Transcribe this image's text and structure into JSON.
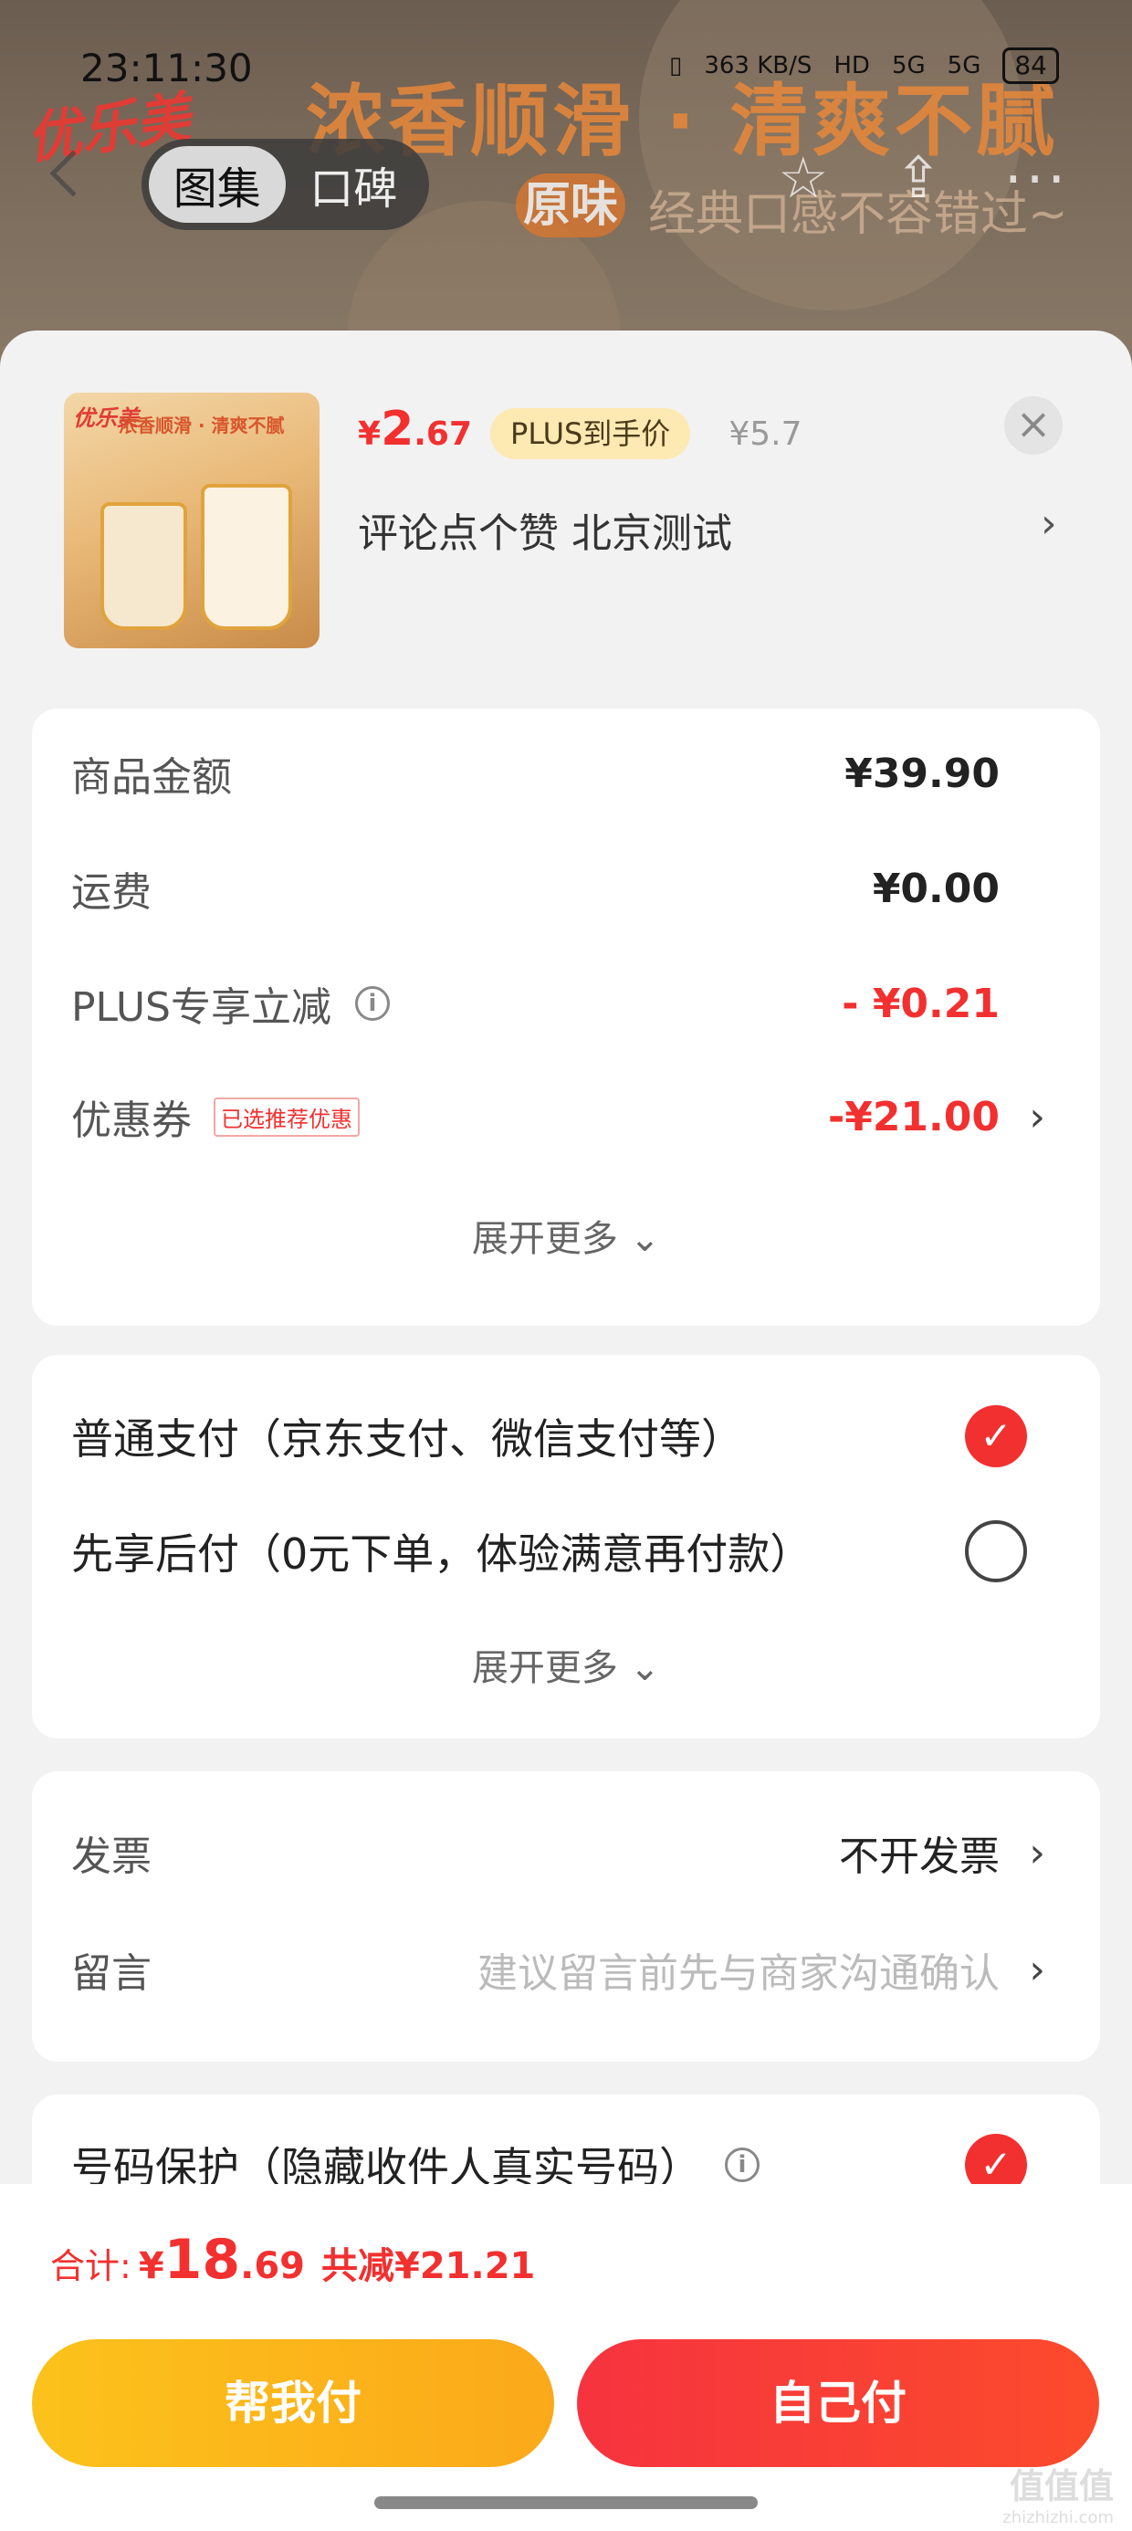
{
  "status_bar": {
    "time": "23:11:30",
    "net_speed": "363 KB/S",
    "hd": "HD",
    "sig1": "5G",
    "sig2": "5G",
    "battery": "84"
  },
  "banner": {
    "title": "浓香顺滑 · 清爽不腻",
    "badge": "原味",
    "subtitle": "经典口感不容错过~",
    "logo": "优乐美"
  },
  "nav": {
    "tab_gallery": "图集",
    "tab_reviews": "口碑",
    "star_icon": "☆",
    "share_icon": "⇪",
    "more_icon": "···"
  },
  "product": {
    "image_text": "浓香顺滑 · 清爽不腻",
    "image_logo": "优乐美",
    "price_symbol": "¥",
    "price_int": "2",
    "price_dec": ".67",
    "plus_tag": "PLUS到手价",
    "original_price": "¥5.7",
    "spec": "评论点个赞  北京测试",
    "close": "×"
  },
  "amounts": {
    "goods_label": "商品金额",
    "goods_value": "¥39.90",
    "shipping_label": "运费",
    "shipping_value": "¥0.00",
    "plus_label": "PLUS专享立减",
    "plus_value": "- ¥0.21",
    "coupon_label": "优惠券",
    "coupon_tag": "已选推荐优惠",
    "coupon_value": "-¥21.00",
    "expand": "展开更多 ⌄"
  },
  "payment": {
    "normal": "普通支付（京东支付、微信支付等）",
    "later": "先享后付（0元下单，体验满意再付款）",
    "expand": "展开更多 ⌄",
    "normal_selected": true
  },
  "extra": {
    "invoice_label": "发票",
    "invoice_value": "不开发票",
    "note_label": "留言",
    "note_placeholder": "建议留言前先与商家沟通确认"
  },
  "privacy": {
    "label": "号码保护（隐藏收件人真实号码）"
  },
  "footer": {
    "total_label": "合计:",
    "total_symbol": "¥",
    "total_int": "18",
    "total_dec": ".69",
    "total_saved": "共减¥21.21",
    "help_pay": "帮我付",
    "self_pay": "自己付",
    "watermark": "值值值",
    "watermark_url": "zhizhizhi.com"
  },
  "arrow": "›",
  "check": "✓",
  "colors": {
    "accent_red": "#f23030",
    "accent_yellow": "#fcc21b",
    "plus_tag_bg": "#fde9b2"
  }
}
